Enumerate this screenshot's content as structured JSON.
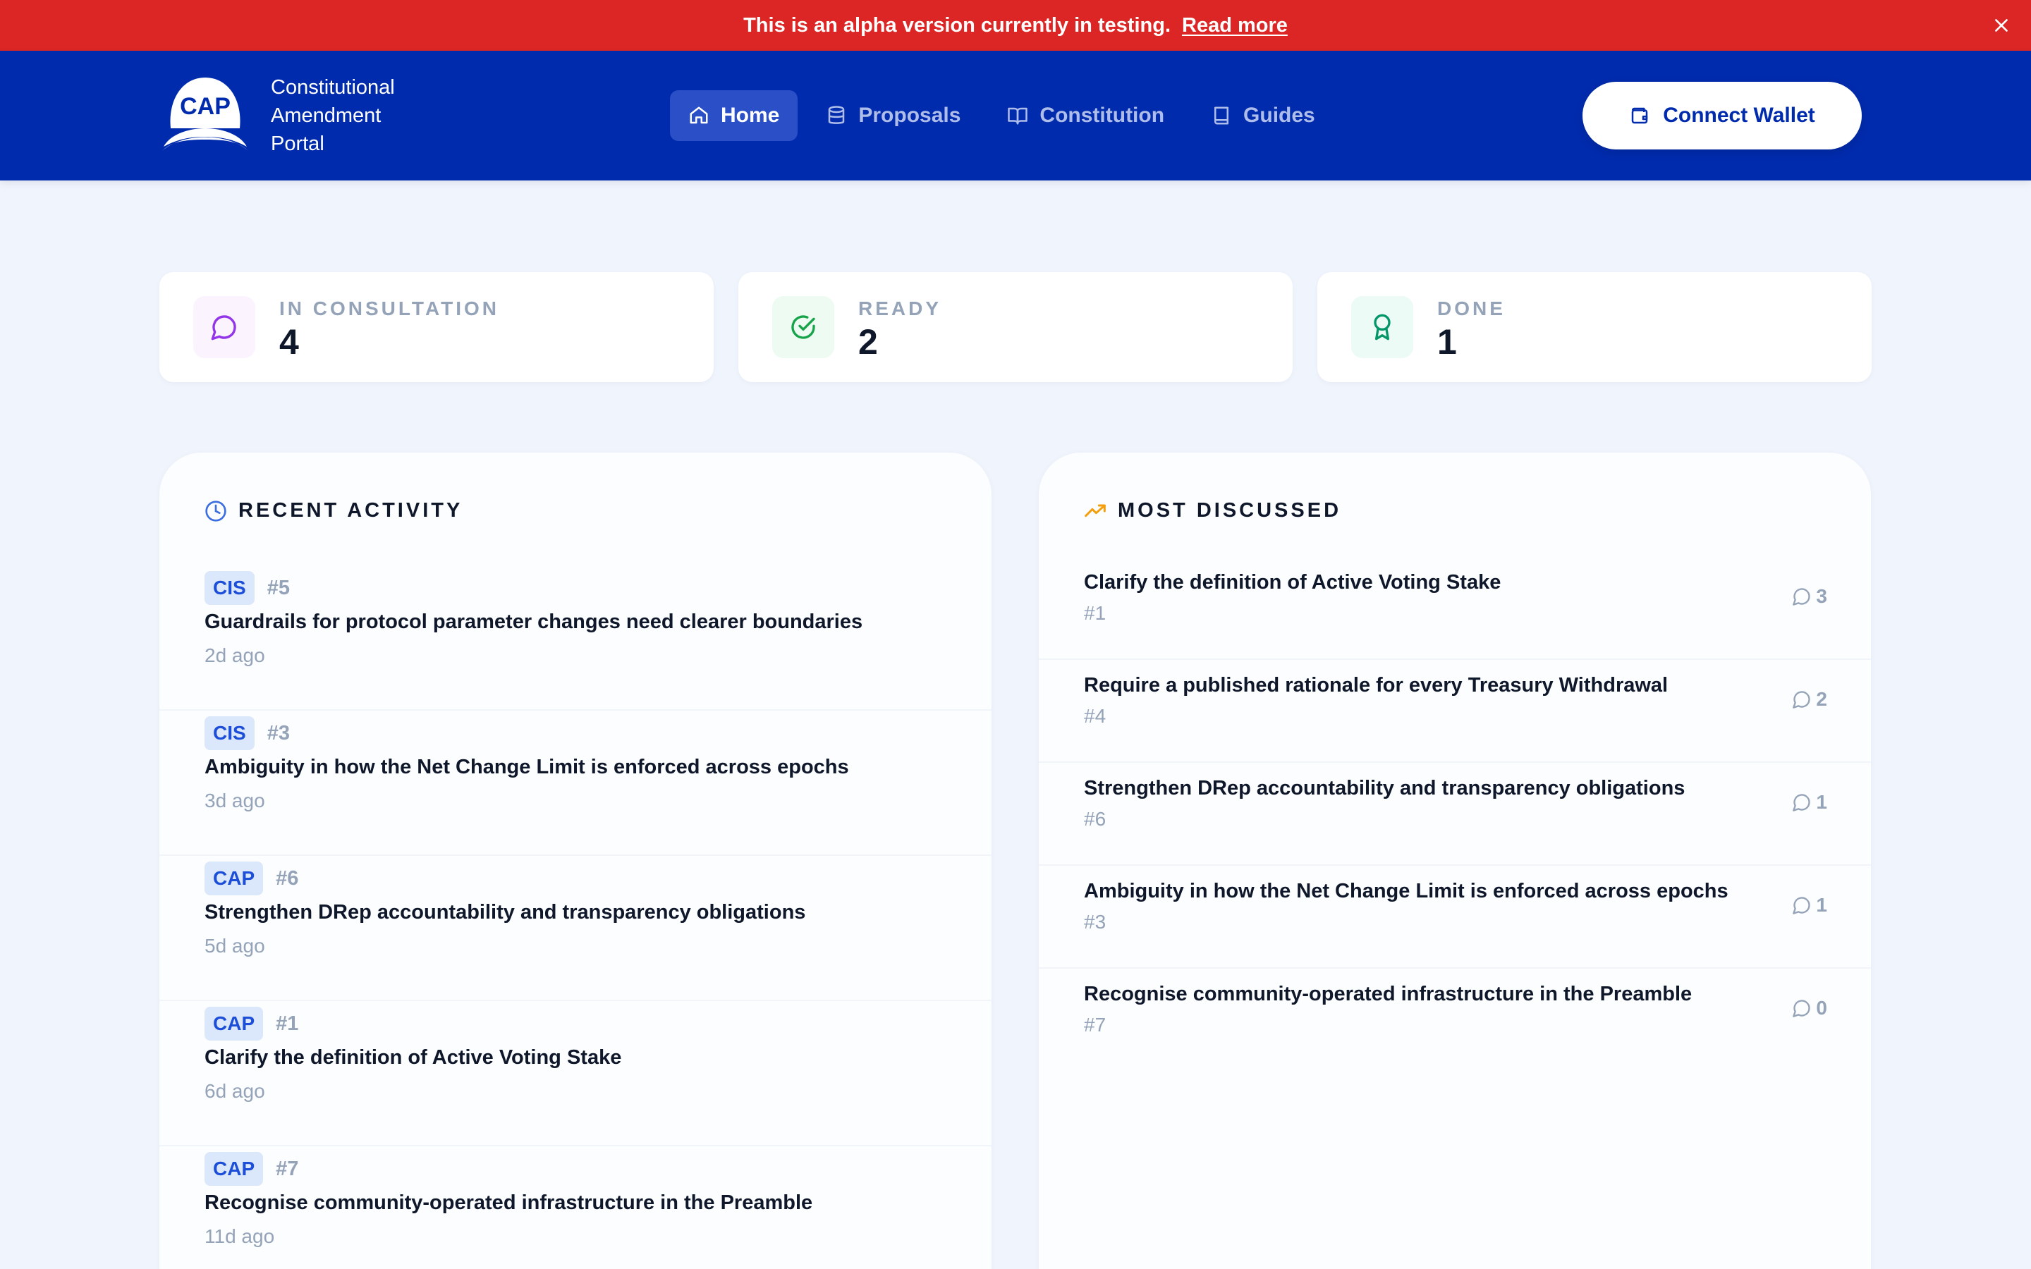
{
  "banner": {
    "message": "This is an alpha version currently in testing.",
    "link": "Read more"
  },
  "header": {
    "logo_text": "CAP",
    "title": "Constitutional Amendment Portal",
    "nav": [
      {
        "label": "Home",
        "icon": "home-icon",
        "active": true
      },
      {
        "label": "Proposals",
        "icon": "database-icon",
        "active": false
      },
      {
        "label": "Constitution",
        "icon": "book-open-icon",
        "active": false
      },
      {
        "label": "Guides",
        "icon": "book-icon",
        "active": false
      }
    ],
    "connect_label": "Connect Wallet"
  },
  "stats": [
    {
      "label": "IN CONSULTATION",
      "value": "4",
      "icon": "message-circle-icon",
      "color": "#9333ea",
      "bg": "#fbf3fe"
    },
    {
      "label": "READY",
      "value": "2",
      "icon": "check-circle-icon",
      "color": "#16a34a",
      "bg": "#eefbf2"
    },
    {
      "label": "DONE",
      "value": "1",
      "icon": "award-icon",
      "color": "#059669",
      "bg": "#ecfbf5"
    }
  ],
  "recent_activity": {
    "title": "RECENT ACTIVITY",
    "items": [
      {
        "type": "CIS",
        "num": "#5",
        "title": "Guardrails for protocol parameter changes need clearer boundaries",
        "ago": "2d ago"
      },
      {
        "type": "CIS",
        "num": "#3",
        "title": "Ambiguity in how the Net Change Limit is enforced across epochs",
        "ago": "3d ago"
      },
      {
        "type": "CAP",
        "num": "#6",
        "title": "Strengthen DRep accountability and transparency obligations",
        "ago": "5d ago"
      },
      {
        "type": "CAP",
        "num": "#1",
        "title": "Clarify the definition of Active Voting Stake",
        "ago": "6d ago"
      },
      {
        "type": "CAP",
        "num": "#7",
        "title": "Recognise community-operated infrastructure in the Preamble",
        "ago": "11d ago"
      }
    ]
  },
  "most_discussed": {
    "title": "MOST DISCUSSED",
    "items": [
      {
        "title": "Clarify the definition of Active Voting Stake",
        "num": "#1",
        "count": "3"
      },
      {
        "title": "Require a published rationale for every Treasury Withdrawal",
        "num": "#4",
        "count": "2"
      },
      {
        "title": "Strengthen DRep accountability and transparency obligations",
        "num": "#6",
        "count": "1"
      },
      {
        "title": "Ambiguity in how the Net Change Limit is enforced across epochs",
        "num": "#3",
        "count": "1"
      },
      {
        "title": "Recognise community-operated infrastructure in the Preamble",
        "num": "#7",
        "count": "0"
      }
    ]
  },
  "colors": {
    "banner": "#dc2626",
    "header": "#002bad",
    "accent": "#1d4ed8",
    "trend": "#f59e0b",
    "clock": "#3b6fe0"
  }
}
